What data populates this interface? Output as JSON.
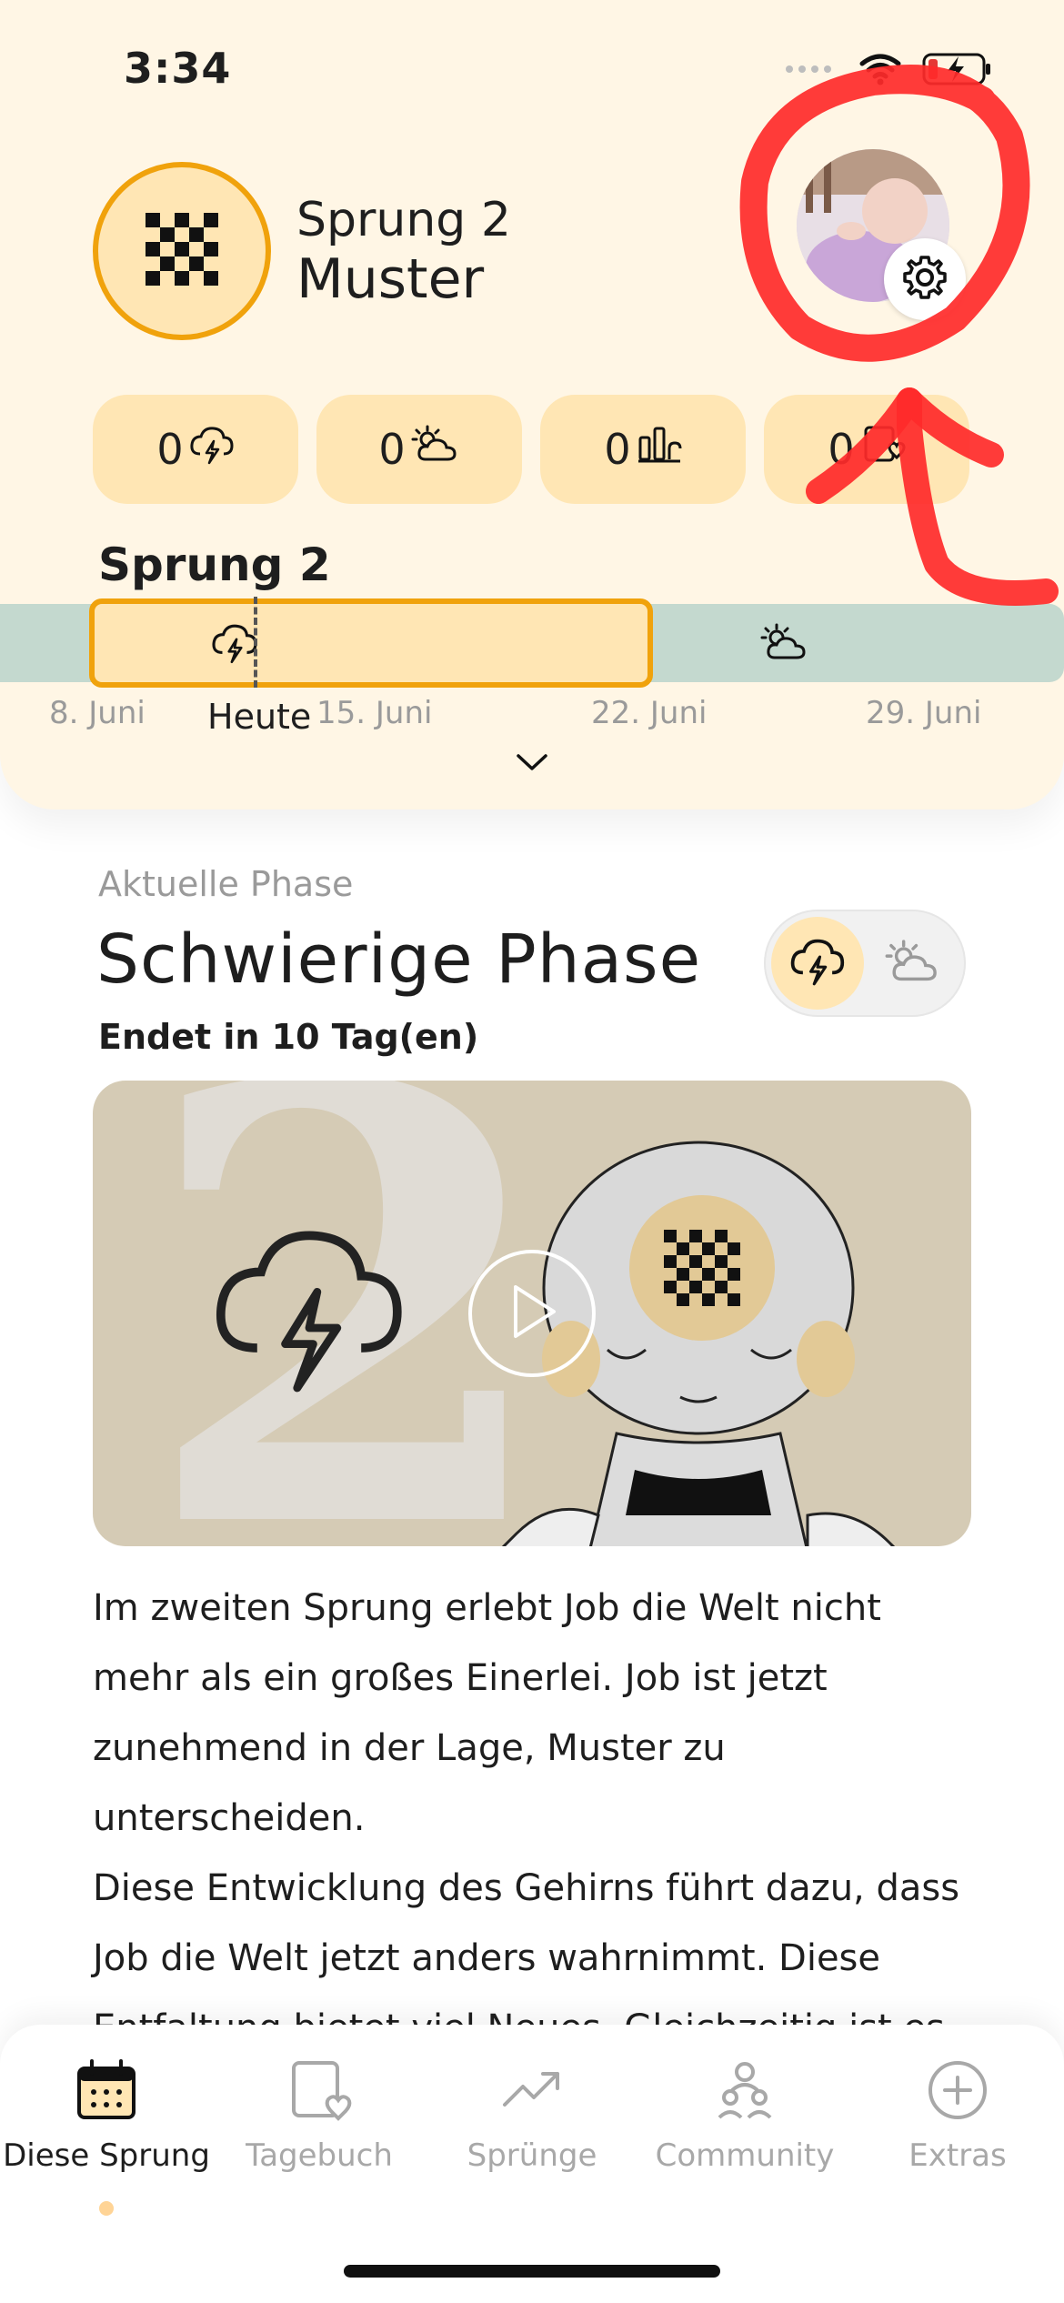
{
  "status_bar": {
    "time": "3:34"
  },
  "header": {
    "leap_title": "Sprung 2",
    "leap_subtitle": "Muster",
    "avatar_icon": "baby-photo",
    "settings_icon": "gear-icon"
  },
  "counters": [
    {
      "value": "0",
      "icon": "storm-cloud-icon"
    },
    {
      "value": "0",
      "icon": "sun-cloud-icon"
    },
    {
      "value": "0",
      "icon": "skill-blocks-icon"
    },
    {
      "value": "0",
      "icon": "diary-heart-icon"
    }
  ],
  "timeline": {
    "title": "Sprung 2",
    "dates": [
      "8. Juni",
      "15. Juni",
      "22. Juni",
      "29. Juni"
    ],
    "today_label": "Heute"
  },
  "phase": {
    "label": "Aktuelle Phase",
    "title": "Schwierige Phase",
    "ends": "Endet in 10 Tag(en)",
    "video_number": "2"
  },
  "description": {
    "paragraph1": "Im zweiten Sprung erlebt Job die Welt nicht mehr als ein großes Einerlei. Job ist jetzt zunehmend in der Lage, Muster zu unterscheiden.",
    "paragraph2": "Diese Entwicklung des Gehirns führt dazu, dass Job die Welt jetzt anders wahrnimmt. Diese Entfaltung bietet viel Neues. Gleichzeitig ist es"
  },
  "nav": [
    {
      "label": "Diese Sprung",
      "icon": "calendar-icon",
      "active": true
    },
    {
      "label": "Tagebuch",
      "icon": "diary-heart-icon",
      "active": false
    },
    {
      "label": "Sprünge",
      "icon": "trend-icon",
      "active": false
    },
    {
      "label": "Community",
      "icon": "community-icon",
      "active": false
    },
    {
      "label": "Extras",
      "icon": "plus-circle-icon",
      "active": false
    }
  ],
  "colors": {
    "header_bg": "#fff6e5",
    "accent_orange": "#f0a20c",
    "chip_bg": "#ffe6b4",
    "timeline_green": "#c4d9cf",
    "annotation_red": "#ff2a2a"
  }
}
